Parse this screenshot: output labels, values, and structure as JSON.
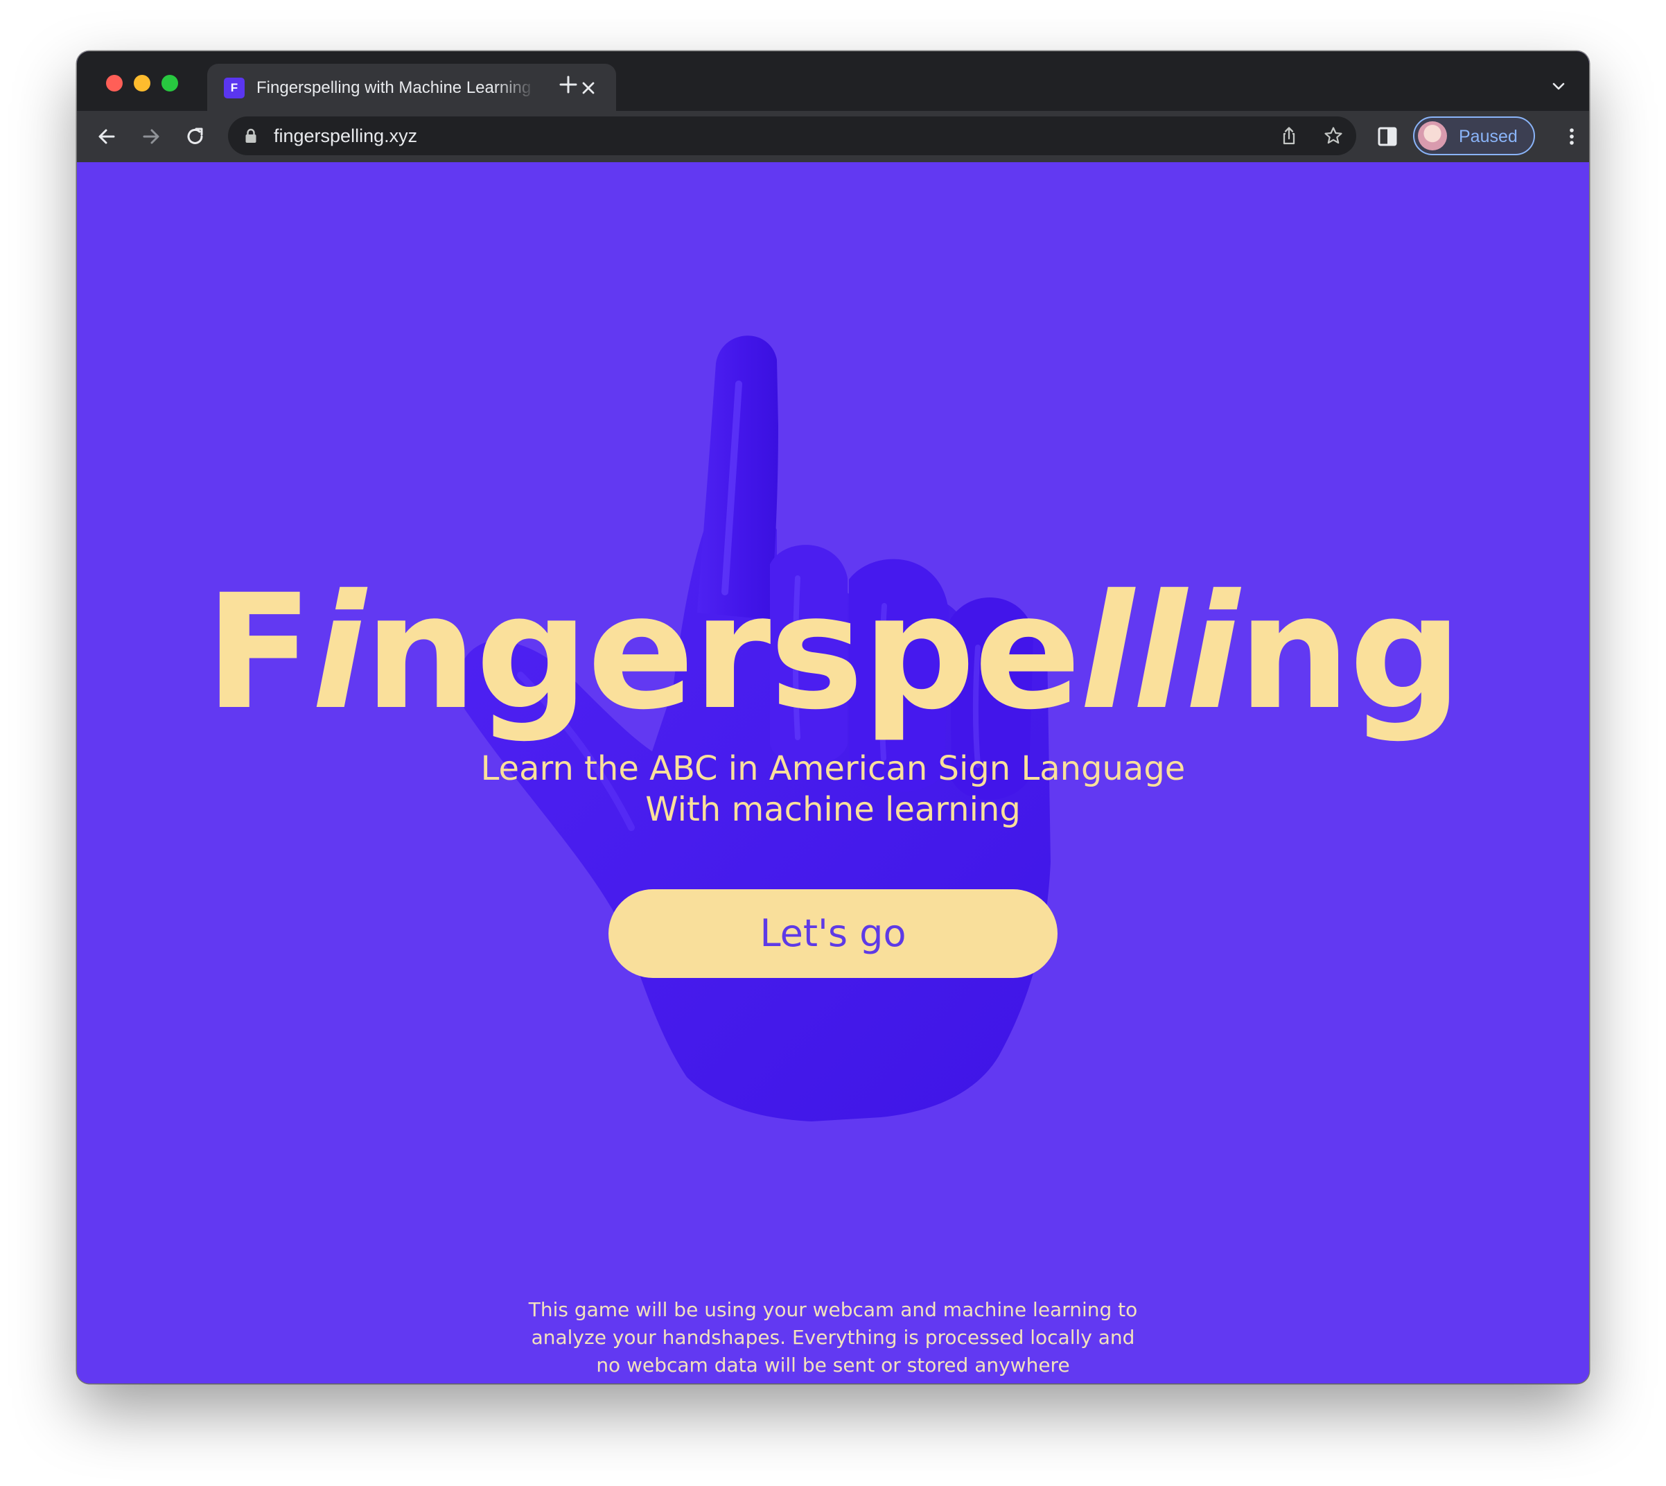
{
  "browser": {
    "tab": {
      "favicon_letter": "F",
      "title": "Fingerspelling with Machine Learning"
    },
    "omnibox": {
      "url": "fingerspelling.xyz"
    },
    "profile": {
      "label": "Paused"
    }
  },
  "page": {
    "title_parts": [
      "F",
      "i",
      "ngerspe",
      "lli",
      "ng"
    ],
    "subtitle_lines": [
      "Learn the ABC in American Sign Language",
      "With machine learning"
    ],
    "cta_label": "Let's go",
    "disclaimer_lines": [
      "This game will be using your webcam and machine learning to",
      "analyze your handshapes. Everything is processed locally and",
      "no webcam data will be sent or stored anywhere"
    ]
  },
  "colors": {
    "background": "#6239f2",
    "accent_yellow": "#fae09b",
    "button_text": "#5e3ae6",
    "hand": "#4a1ff0"
  },
  "icons": [
    "close-icon",
    "plus-icon",
    "chevron-down-icon",
    "back-arrow-icon",
    "forward-arrow-icon",
    "reload-icon",
    "lock-icon",
    "share-icon",
    "star-icon",
    "side-panel-icon",
    "kebab-menu-icon",
    "hand-illustration"
  ]
}
